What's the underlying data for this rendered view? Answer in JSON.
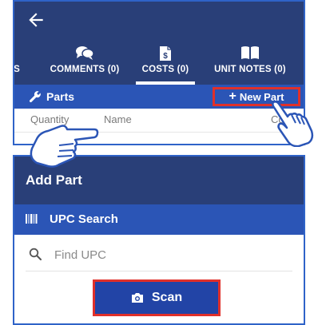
{
  "top_panel": {
    "tabs": [
      {
        "label": "S",
        "icon": "partial-tab"
      },
      {
        "label": "COMMENTS (0)",
        "icon": "chat-bubbles-icon"
      },
      {
        "label": "COSTS (0)",
        "icon": "dollar-document-icon",
        "active": true
      },
      {
        "label": "UNIT NOTES (0)",
        "icon": "open-book-icon"
      }
    ],
    "parts_title": "Parts",
    "new_part_label": "New Part",
    "columns": [
      "Quantity",
      "Name",
      "Cos"
    ]
  },
  "add_part_panel": {
    "title": "Add Part",
    "upc_title": "UPC Search",
    "search_placeholder": "Find UPC",
    "scan_label": "Scan"
  },
  "colors": {
    "header_bg": "#293f78",
    "bar_bg": "#2b55b6",
    "button_bg": "#2244a6",
    "highlight_border": "#e0302a",
    "panel_border": "#2f63c8"
  }
}
